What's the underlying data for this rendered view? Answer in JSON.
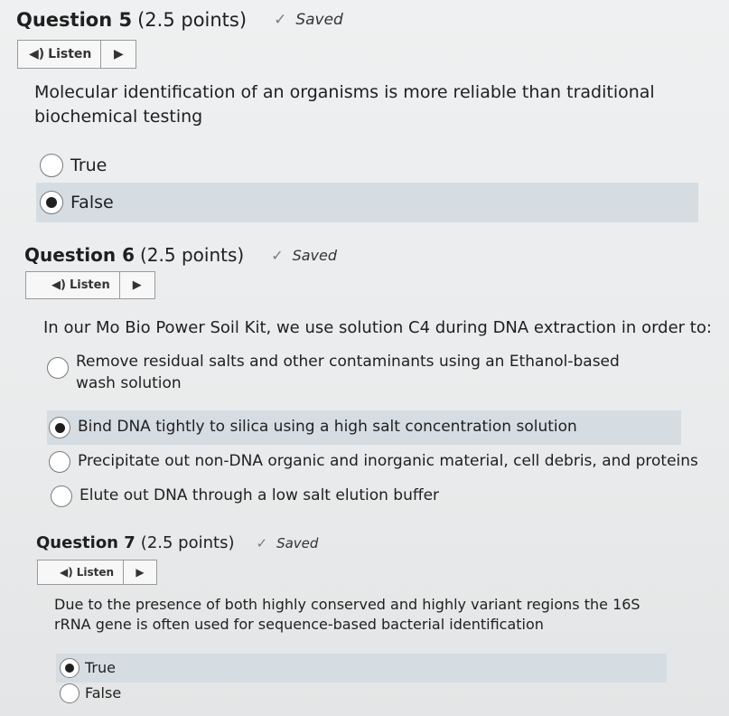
{
  "questions": [
    {
      "title": "Question 5",
      "points": "(2.5 points)",
      "status": "Saved",
      "listen_label": "Listen",
      "prompt": "Molecular identification of an organisms is more reliable than traditional biochemical testing",
      "options": [
        {
          "label": "True",
          "selected": false
        },
        {
          "label": "False",
          "selected": true
        }
      ]
    },
    {
      "title": "Question 6",
      "points": "(2.5 points)",
      "status": "Saved",
      "listen_label": "Listen",
      "prompt": "In our Mo Bio Power Soil Kit, we use solution C4 during DNA extraction in order to:",
      "options": [
        {
          "label": "Remove residual salts and other contaminants using an Ethanol-based wash solution",
          "selected": false
        },
        {
          "label": "Bind DNA tightly to silica using a high salt concentration solution",
          "selected": true
        },
        {
          "label": "Precipitate out non-DNA organic and inorganic material, cell debris, and proteins",
          "selected": false
        },
        {
          "label": "Elute out DNA through a low salt elution buffer",
          "selected": false
        }
      ]
    },
    {
      "title": "Question 7",
      "points": "(2.5 points)",
      "status": "Saved",
      "listen_label": "Listen",
      "prompt": "Due to the presence of both highly conserved and highly variant regions the 16S rRNA gene is often used for sequence-based bacterial identification",
      "options": [
        {
          "label": "True",
          "selected": true
        },
        {
          "label": "False",
          "selected": false
        }
      ]
    }
  ]
}
